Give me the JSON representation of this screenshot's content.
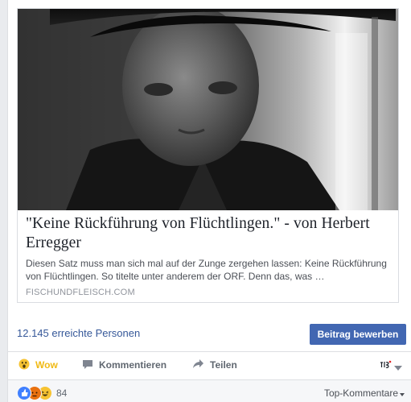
{
  "link_card": {
    "title": "\"Keine Rückführung von Flüchtlingen.\" - von Herbert Erregger",
    "description": "Diesen Satz muss man sich mal auf der Zunge zergehen lassen: Keine Rückführung von Flüchtlingen. So titelte unter anderem der ORF. Denn das, was …",
    "domain": "FISCHUNDFLEISCH.COM"
  },
  "reach": {
    "text": "12.145 erreichte Personen",
    "boost_label": "Beitrag bewerben"
  },
  "actions": {
    "wow": "Wow",
    "comment": "Kommentieren",
    "share": "Teilen"
  },
  "reactions": {
    "count": "84"
  },
  "sort": {
    "label": "Top-Kommentare"
  },
  "colors": {
    "link": "#365899",
    "boost": "#4267b2",
    "wow": "#f0ba15"
  }
}
